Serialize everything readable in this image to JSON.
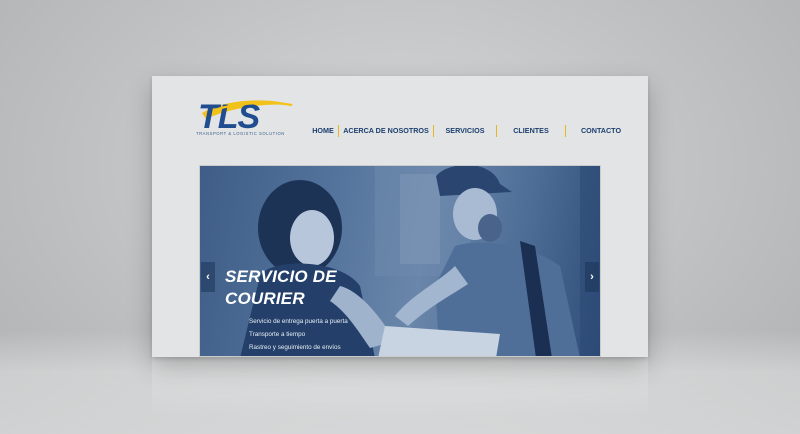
{
  "brand": {
    "logo_text": "TLS",
    "tagline": "TRANSPORT & LOGISTIC SOLUTION",
    "colors": {
      "blue": "#1f4d8f",
      "yellow": "#f2c21a",
      "nav_text": "#1c3f6e"
    }
  },
  "nav": {
    "items": [
      {
        "label": "HOME"
      },
      {
        "label": "ACERCA DE NOSOTROS"
      },
      {
        "label": "SERVICIOS"
      },
      {
        "label": "CLIENTES"
      },
      {
        "label": "CONTACTO"
      }
    ]
  },
  "hero": {
    "title": "SERVICIO DE COURIER",
    "bullets": [
      "Servicio de entrega puerta a puerta",
      "Transporte a tiempo",
      "Rastreo y seguimiento de envíos"
    ],
    "prev_icon": "chevron-left-icon",
    "next_icon": "chevron-right-icon",
    "overlay_color": "#3f5d86"
  }
}
